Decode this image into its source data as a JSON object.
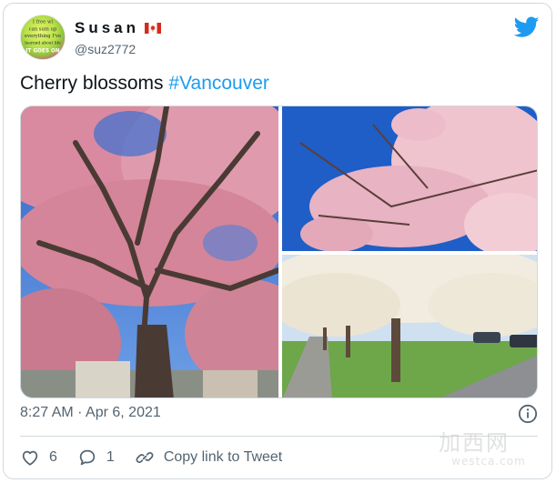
{
  "tweet": {
    "author": {
      "display_name": "Susan",
      "flag_icon": "canada-flag-icon",
      "handle": "@suz2772",
      "avatar_text": [
        "I free wi",
        "can sum up",
        "everything I've",
        "learned about life",
        "IT GOES ON"
      ]
    },
    "brand_icon": "twitter-bird-icon",
    "text": {
      "body": "Cherry blossoms ",
      "hashtag": "#Vancouver"
    },
    "media_alt": [
      "pink-cherry-tree-photo",
      "pink-blossom-closeup-photo",
      "white-blossom-street-photo"
    ],
    "timestamp": "8:27 AM · Apr 6, 2021",
    "actions": {
      "like_count": "6",
      "reply_count": "1",
      "copy_link_label": "Copy link to Tweet"
    },
    "watermark": {
      "cn": "加西网",
      "url": "westca.com"
    }
  },
  "colors": {
    "accent": "#1d9bf0",
    "text": "#0f1419",
    "muted": "#536471",
    "border": "#cfd9de"
  }
}
